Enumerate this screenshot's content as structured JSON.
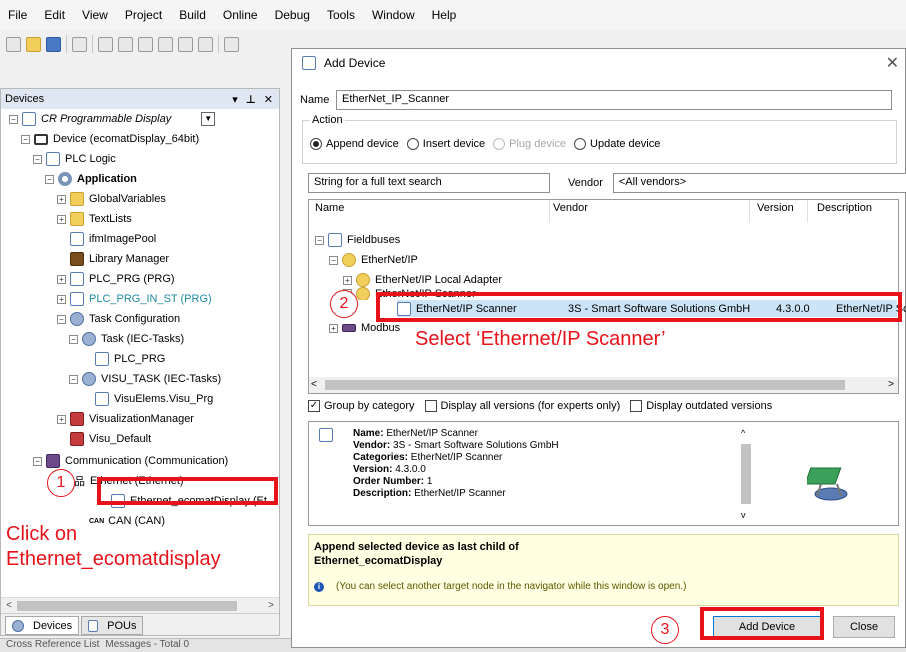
{
  "menubar": [
    "File",
    "Edit",
    "View",
    "Project",
    "Build",
    "Online",
    "Debug",
    "Tools",
    "Window",
    "Help"
  ],
  "devices_panel": {
    "title": "Devices",
    "tree": [
      {
        "label": "CR Programmable Display",
        "icon": "project-icon",
        "style": "italic"
      },
      {
        "label": "Device (ecomatDisplay_64bit)",
        "icon": "device-icon"
      },
      {
        "label": "PLC Logic",
        "icon": "plc-logic-icon"
      },
      {
        "label": "Application",
        "icon": "application-gear-icon",
        "style": "bold"
      },
      {
        "label": "GlobalVariables",
        "icon": "folder-icon"
      },
      {
        "label": "TextLists",
        "icon": "folder-icon"
      },
      {
        "label": "ifmImagePool",
        "icon": "image-pool-icon"
      },
      {
        "label": "Library Manager",
        "icon": "library-icon"
      },
      {
        "label": "PLC_PRG (PRG)",
        "icon": "program-icon"
      },
      {
        "label": "PLC_PRG_IN_ST (PRG)",
        "icon": "program-icon",
        "style": "teal"
      },
      {
        "label": "Task Configuration",
        "icon": "task-config-icon"
      },
      {
        "label": "Task (IEC-Tasks)",
        "icon": "task-icon"
      },
      {
        "label": "PLC_PRG",
        "icon": "program-call-icon"
      },
      {
        "label": "VISU_TASK (IEC-Tasks)",
        "icon": "task-icon"
      },
      {
        "label": "VisuElems.Visu_Prg",
        "icon": "program-call-icon"
      },
      {
        "label": "VisualizationManager",
        "icon": "visu-manager-icon"
      },
      {
        "label": "Visu_Default",
        "icon": "visu-icon"
      },
      {
        "label": "Communication (Communication)",
        "icon": "communication-icon"
      },
      {
        "label": "Ethernet (Ethernet)",
        "icon": "ethernet-icon"
      },
      {
        "label": "Ethernet_ecomatDisplay (Et",
        "icon": "ethernet-device-icon"
      },
      {
        "label": "CAN (CAN)",
        "icon": "can-icon"
      }
    ],
    "tabs": [
      "Devices",
      "POUs"
    ]
  },
  "bottom_strip": [
    "Cross Reference List",
    "Messages - Total 0"
  ],
  "dialog": {
    "title": "Add Device",
    "name_label": "Name",
    "name_value": "EtherNet_IP_Scanner",
    "action_label": "Action",
    "actions": [
      {
        "label": "Append device",
        "selected": true,
        "enabled": true
      },
      {
        "label": "Insert device",
        "selected": false,
        "enabled": true
      },
      {
        "label": "Plug device",
        "selected": false,
        "enabled": false
      },
      {
        "label": "Update device",
        "selected": false,
        "enabled": true
      }
    ],
    "search_placeholder": "String for a full text search",
    "vendor_label": "Vendor",
    "vendor_value": "<All vendors>",
    "columns": [
      "Name",
      "Vendor",
      "Version",
      "Description"
    ],
    "tree": [
      {
        "name": "Fieldbuses"
      },
      {
        "name": "EtherNet/IP"
      },
      {
        "name": "EtherNet/IP Local Adapter"
      },
      {
        "name": "EtherNet/IP Scanner"
      },
      {
        "name": "EtherNet/IP Scanner",
        "vendor": "3S - Smart Software Solutions GmbH",
        "version": "4.3.0.0",
        "description": "EtherNet/IP Sca"
      },
      {
        "name": "Modbus"
      }
    ],
    "options": [
      {
        "label": "Group by category",
        "checked": true
      },
      {
        "label": "Display all versions (for experts only)",
        "checked": false
      },
      {
        "label": "Display outdated versions",
        "checked": false
      }
    ],
    "info": {
      "name_label": "Name:",
      "name": "EtherNet/IP Scanner",
      "vendor_label": "Vendor:",
      "vendor": "3S - Smart Software Solutions GmbH",
      "categories_label": "Categories:",
      "categories": "EtherNet/IP Scanner",
      "version_label": "Version:",
      "version": "4.3.0.0",
      "order_label": "Order Number:",
      "order": "1",
      "description_label": "Description:",
      "description": "EtherNet/IP Scanner"
    },
    "message_line1": "Append selected device as last child of",
    "message_line2": "Ethernet_ecomatDisplay",
    "message_hint": "(You can select another target node in the navigator while this window is open.)",
    "add_button": "Add Device",
    "close_button": "Close"
  },
  "annotations": {
    "step1": "1",
    "step2": "2",
    "step3": "3",
    "note1_line1": "Click on",
    "note1_line2": "Ethernet_ecomatdisplay",
    "note2": "Select ‘Ethernet/IP Scanner’"
  },
  "colors": {
    "annotation_red": "#e8121a",
    "selection_blue": "#cce4f7",
    "message_yellow": "#ffffe1"
  }
}
